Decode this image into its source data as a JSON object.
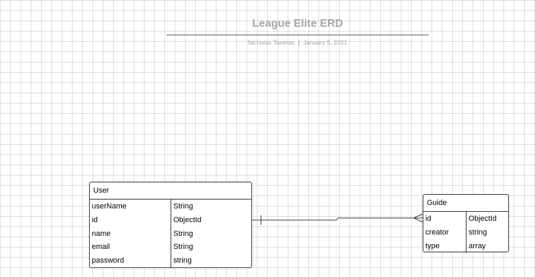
{
  "header": {
    "title": "League Elite ERD",
    "author": "Nicholas Taveras",
    "separator": "|",
    "date": "January 5, 2021"
  },
  "entities": {
    "user": {
      "name": "User",
      "fields": [
        {
          "name": "userName",
          "type": "String"
        },
        {
          "name": "id",
          "type": "ObjectId"
        },
        {
          "name": "name",
          "type": "String"
        },
        {
          "name": "email",
          "type": "String"
        },
        {
          "name": "password",
          "type": "string"
        }
      ]
    },
    "guide": {
      "name": "Guide",
      "fields": [
        {
          "name": "id",
          "type": "ObjectId"
        },
        {
          "name": "creator",
          "type": "string"
        },
        {
          "name": "type",
          "type": "array"
        }
      ]
    }
  },
  "relationship": {
    "from_cardinality": "one",
    "to_cardinality": "many"
  },
  "colors": {
    "grid": "#dcdcdc",
    "header_text": "#a6a6a6",
    "border": "#333333",
    "line": "#333333"
  }
}
